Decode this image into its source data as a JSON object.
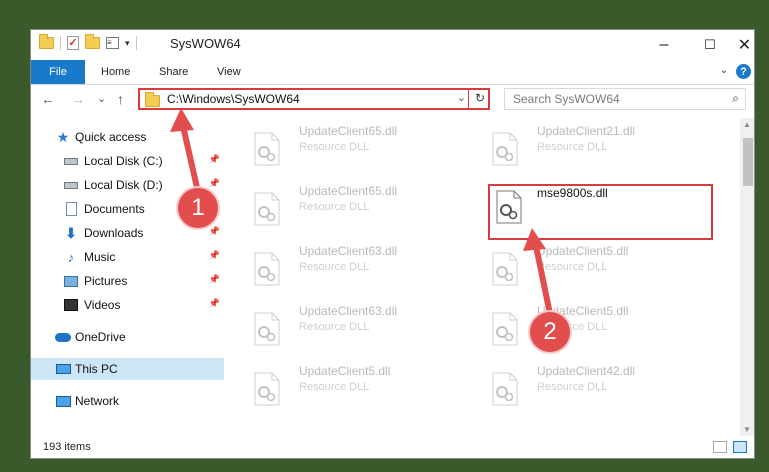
{
  "window": {
    "title": "SysWOW64",
    "minimize": "–",
    "maximize": "☐",
    "close": "✕"
  },
  "ribbon": {
    "file": "File",
    "tabs": [
      "Home",
      "Share",
      "View"
    ],
    "help": "?"
  },
  "nav": {
    "back": "←",
    "forward": "→",
    "recent": "⌄",
    "up": "↑"
  },
  "address": {
    "path": "C:\\Windows\\SysWOW64",
    "dropdown": "⌄",
    "refresh": "↻"
  },
  "search": {
    "placeholder": "Search SysWOW64",
    "icon": "⌕"
  },
  "sidebar": {
    "items": [
      {
        "label": "Quick access",
        "icon": "star-icon",
        "pinned": false
      },
      {
        "label": "Local Disk (C:)",
        "icon": "drive-icon",
        "pinned": true
      },
      {
        "label": "Local Disk (D:)",
        "icon": "drive-icon",
        "pinned": true
      },
      {
        "label": "Documents",
        "icon": "document-icon",
        "pinned": true
      },
      {
        "label": "Downloads",
        "icon": "download-icon",
        "pinned": true
      },
      {
        "label": "Music",
        "icon": "music-icon",
        "pinned": true
      },
      {
        "label": "Pictures",
        "icon": "pictures-icon",
        "pinned": true
      },
      {
        "label": "Videos",
        "icon": "video-icon",
        "pinned": true
      },
      {
        "label": "OneDrive",
        "icon": "onedrive-icon",
        "pinned": false
      },
      {
        "label": "This PC",
        "icon": "computer-icon",
        "pinned": false,
        "selected": true
      },
      {
        "label": "Network",
        "icon": "network-icon",
        "pinned": false
      }
    ]
  },
  "files": [
    {
      "name": "UpdateClient65.dll",
      "type": "Resource DLL"
    },
    {
      "name": "UpdateClient21.dll",
      "type": "Resource DLL"
    },
    {
      "name": "UpdateClient65.dll",
      "type": "Resource DLL"
    },
    {
      "name": "mse9800s.dll",
      "type": ""
    },
    {
      "name": "UpdateClient63.dll",
      "type": "Resource DLL"
    },
    {
      "name": "UpdateClient5.dll",
      "type": "Resource DLL"
    },
    {
      "name": "UpdateClient63.dll",
      "type": "Resource DLL"
    },
    {
      "name": "UpdateClient5.dll",
      "type": "Resource DLL"
    },
    {
      "name": "UpdateClient5.dll",
      "type": "Resource DLL"
    },
    {
      "name": "UpdateClient42.dll",
      "type": "Resource DLL"
    }
  ],
  "status": {
    "count": "193 items"
  },
  "annotations": {
    "step1": "1",
    "step2": "2",
    "color": "#e24d4d"
  }
}
